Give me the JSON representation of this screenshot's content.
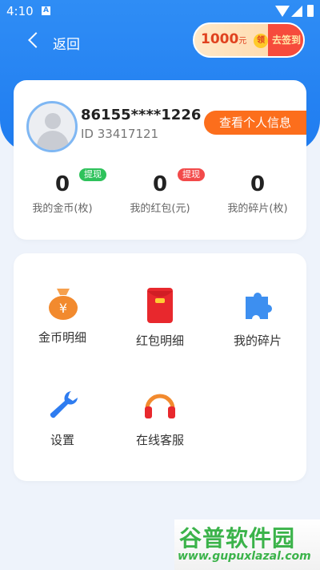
{
  "status_bar": {
    "time": "4:10",
    "notif_icon": "A"
  },
  "header": {
    "back_label": "返回"
  },
  "signin": {
    "coins": "1000",
    "unit": "元",
    "ling": "领",
    "action": "去签到"
  },
  "profile": {
    "phone": "86155****1226",
    "id_label": "ID 33417121",
    "info_button": "查看个人信息",
    "stats": [
      {
        "value": "0",
        "label": "我的金币(枚)",
        "badge": "提现",
        "badge_color": "#2ec25b"
      },
      {
        "value": "0",
        "label": "我的红包(元)",
        "badge": "提现",
        "badge_color": "#f24a4a"
      },
      {
        "value": "0",
        "label": "我的碎片(枚)"
      }
    ]
  },
  "menu": {
    "items": [
      {
        "label": "金币明细",
        "icon": "money-bag-icon"
      },
      {
        "label": "红包明细",
        "icon": "red-envelope-icon"
      },
      {
        "label": "我的碎片",
        "icon": "puzzle-piece-icon"
      },
      {
        "label": "设置",
        "icon": "wrench-icon"
      },
      {
        "label": "在线客服",
        "icon": "headphones-icon"
      }
    ]
  },
  "watermark": {
    "title": "谷普软件园",
    "url": "www.gupuxlazal.com"
  }
}
